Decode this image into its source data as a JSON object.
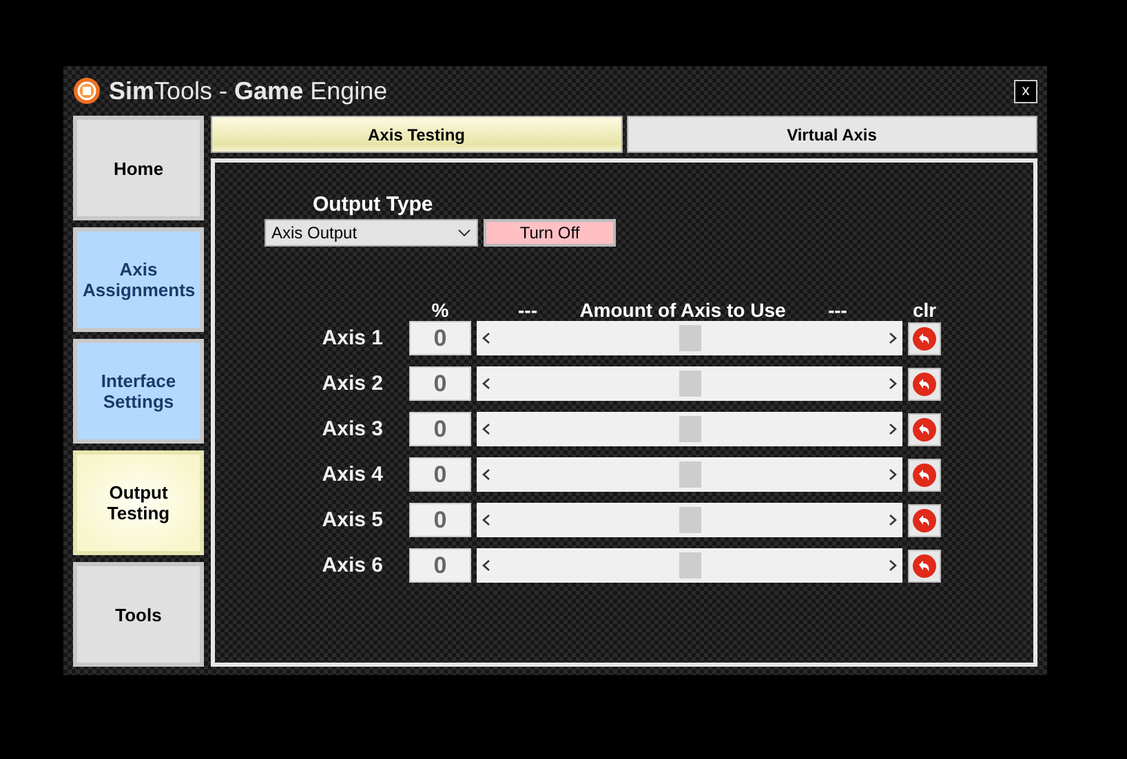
{
  "window": {
    "title": "**Sim**Tools - **Game** Engine",
    "close": "x"
  },
  "sidebar": {
    "items": [
      {
        "label": "Home",
        "color": "#e0e0e0",
        "selected": false
      },
      {
        "label": "Axis Assignments",
        "color": "#b3d9ff",
        "selected": false
      },
      {
        "label": "Interface Settings",
        "color": "#b3d9ff",
        "selected": false
      },
      {
        "label": "Output Testing",
        "color": "#f8f6cc",
        "selected": true
      },
      {
        "label": "Tools",
        "color": "#e0e0e0",
        "selected": false
      }
    ]
  },
  "tabs": [
    {
      "label": "Axis Testing",
      "selected": true
    },
    {
      "label": "Virtual Axis",
      "selected": false
    }
  ],
  "output_type": {
    "label": "Output Type",
    "value": "Axis Output",
    "button": "Turn Off"
  },
  "axes_header": {
    "percent": "%",
    "dash_left": "---",
    "title": "Amount of Axis to Use",
    "dash_right": "---",
    "clear": "clr"
  },
  "axes": [
    {
      "name": "Axis 1",
      "value": "0",
      "level": 0.5
    },
    {
      "name": "Axis 2",
      "value": "0",
      "level": 0.5
    },
    {
      "name": "Axis 3",
      "value": "0",
      "level": 0.5
    },
    {
      "name": "Axis 4",
      "value": "0",
      "level": 0.5
    },
    {
      "name": "Axis 5",
      "value": "0",
      "level": 0.5
    },
    {
      "name": "Axis 6",
      "value": "0",
      "level": 0.5
    }
  ]
}
